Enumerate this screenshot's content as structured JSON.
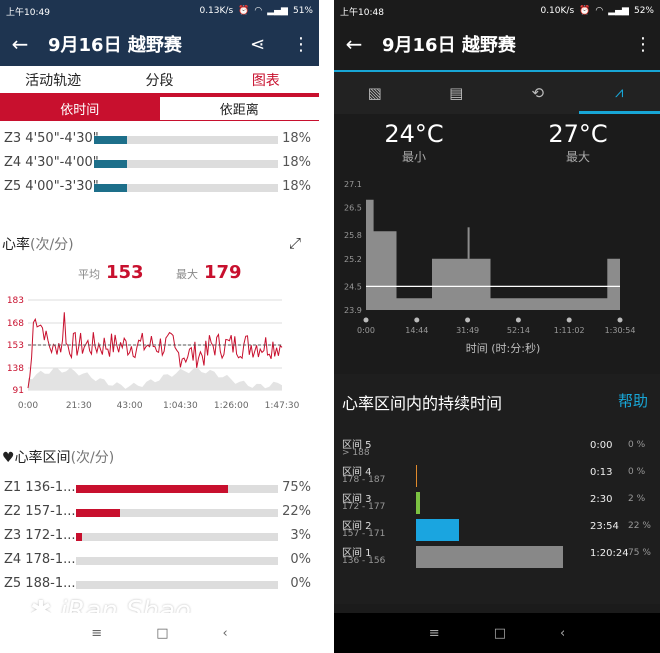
{
  "left": {
    "status": {
      "time": "上午10:49",
      "speed": "0.13K/s",
      "battery": "51%"
    },
    "title": "9月16日 越野赛",
    "tabs": [
      "活动轨迹",
      "分段",
      "图表"
    ],
    "segments": [
      "依时间",
      "依距离"
    ],
    "pace_zones": [
      {
        "label": "Z3 4'50\"-4'30\"",
        "pct": "18%",
        "value": 0.18
      },
      {
        "label": "Z4 4'30\"-4'00\"",
        "pct": "18%",
        "value": 0.18
      },
      {
        "label": "Z5 4'00\"-3'30\"",
        "pct": "18%",
        "value": 0.18
      }
    ],
    "hr_header": {
      "title": "心率",
      "unit": "(次/分)"
    },
    "hr_stats": {
      "avg_label": "平均",
      "avg": "153",
      "max_label": "最大",
      "max": "179"
    },
    "hr_chart": {
      "y_ticks": [
        "183",
        "168",
        "153",
        "138",
        "91"
      ],
      "x_ticks": [
        "0:00",
        "21:30",
        "43:00",
        "1:04:30",
        "1:26:00",
        "1:47:30"
      ]
    },
    "zones_header": {
      "title": "心率区间",
      "unit": "(次/分)"
    },
    "hr_zones": [
      {
        "label": "Z1 136-1...",
        "pct": "75%",
        "value": 0.75
      },
      {
        "label": "Z2 157-1...",
        "pct": "22%",
        "value": 0.22
      },
      {
        "label": "Z3 172-1...",
        "pct": "3%",
        "value": 0.03
      },
      {
        "label": "Z4 178-1...",
        "pct": "0%",
        "value": 0
      },
      {
        "label": "Z5 188-1...",
        "pct": "0%",
        "value": 0
      }
    ],
    "watermark": "iRan Shao"
  },
  "right": {
    "status": {
      "time": "上午10:48",
      "speed": "0.10K/s",
      "battery": "52%"
    },
    "title": "9月16日 越野赛",
    "temps": {
      "min": "24°C",
      "min_label": "最小",
      "max": "27°C",
      "max_label": "最大"
    },
    "temp_chart": {
      "y_ticks": [
        "27.1",
        "26.5",
        "25.8",
        "25.2",
        "24.5",
        "23.9"
      ],
      "x_ticks": [
        "0:00",
        "14:44",
        "31:49",
        "52:14",
        "1:11:02",
        "1:30:54"
      ],
      "xlabel": "时间 (时:分:秒)"
    },
    "zones_title": "心率区间内的持续时间",
    "help": "帮助",
    "zones": [
      {
        "name": "区间 5",
        "range": "> 188",
        "time": "0:00",
        "pct": "0 %",
        "value": 0
      },
      {
        "name": "区间 4",
        "range": "178 - 187",
        "time": "0:13",
        "pct": "0 %",
        "value": 0.002
      },
      {
        "name": "区间 3",
        "range": "172 - 177",
        "time": "2:30",
        "pct": "2 %",
        "value": 0.02
      },
      {
        "name": "区间 2",
        "range": "157 - 171",
        "time": "23:54",
        "pct": "22 %",
        "value": 0.22
      },
      {
        "name": "区间 1",
        "range": "136 - 156",
        "time": "1:20:24",
        "pct": "75 %",
        "value": 0.75
      }
    ]
  },
  "colors": {
    "accent_red": "#c8102e",
    "header_navy": "#1e3450",
    "pace_teal": "#1d6f8a",
    "garmin_blue": "#18a6d6"
  }
}
